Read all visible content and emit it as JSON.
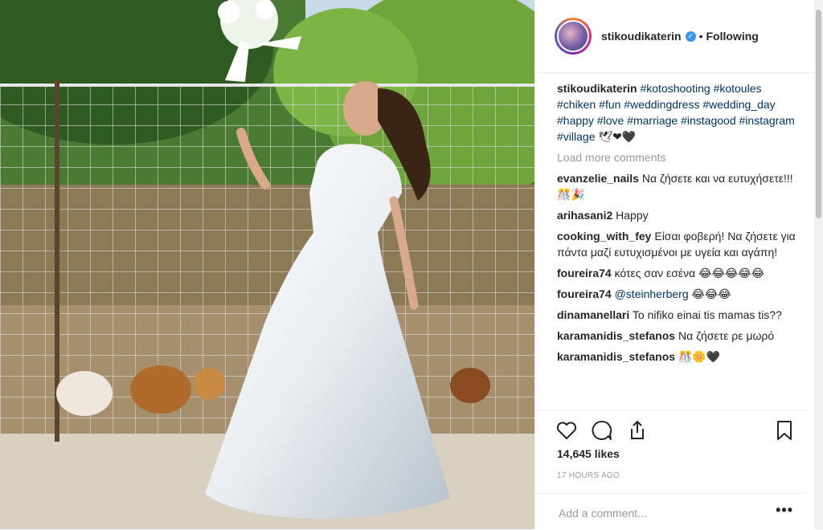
{
  "post": {
    "username": "stikoudikaterin",
    "verified_icon": "verified-badge-icon",
    "dot": "•",
    "follow_status": "Following"
  },
  "caption": {
    "author": "stikoudikaterin",
    "hashtags": [
      "#kotoshooting",
      "#kotoules",
      "#chiken",
      "#fun",
      "#weddingdress",
      "#wedding_day",
      "#happy",
      "#love",
      "#marriage",
      "#instagood",
      "#instagram",
      "#village"
    ],
    "suffix": "🕊❤🖤"
  },
  "load_more": "Load more comments",
  "comments": [
    {
      "author": "evanzelie_nails",
      "text": "Να ζήσετε και να ευτυχήσετε!!!🎊🎉"
    },
    {
      "author": "arihasani2",
      "text": "Happy"
    },
    {
      "author": "cooking_with_fey",
      "text": "Είσαι φοβερή! Να ζήσετε για πάντα μαζί ευτυχισμένοι με υγεία και αγάπη!"
    },
    {
      "author": "foureira74",
      "text": "κότες σαν εσένα 😂😂😂😂😂"
    },
    {
      "author": "foureira74",
      "mention": "@steinherberg",
      "text": "😂😂😂"
    },
    {
      "author": "dinamanellari",
      "text": "To nifiko einai tis mamas tis??"
    },
    {
      "author": "karamanidis_stefanos",
      "text": "Να ζήσετε ρε μωρό"
    },
    {
      "author": "karamanidis_stefanos",
      "text": "🎊🌼🖤"
    }
  ],
  "actions": {
    "like_icon": "heart-icon",
    "comment_icon": "comment-bubble-icon",
    "share_icon": "share-icon",
    "save_icon": "bookmark-icon"
  },
  "likes": "14,645 likes",
  "time_ago": "17 HOURS AGO",
  "add_comment": {
    "placeholder": "Add a comment...",
    "more": "•••"
  }
}
